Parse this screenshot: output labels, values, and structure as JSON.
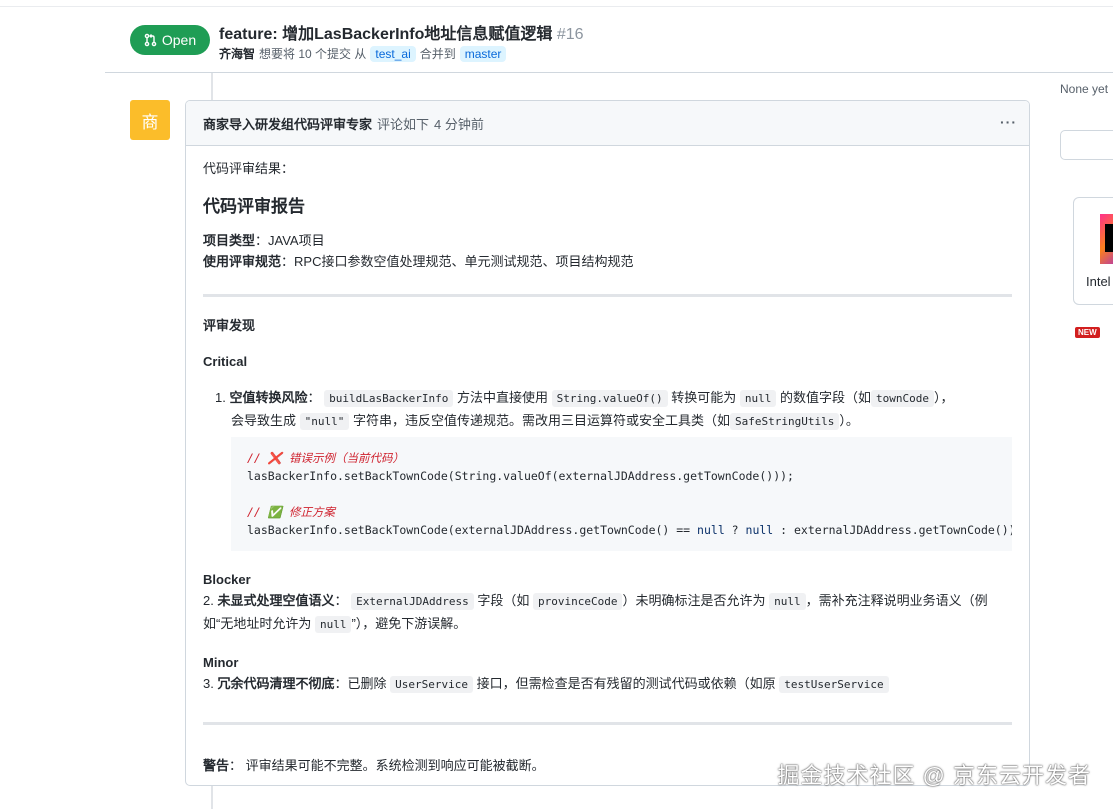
{
  "pr": {
    "status": "Open",
    "title": "feature: 增加LasBackerInfo地址信息赋值逻辑",
    "number": "#16",
    "author": "齐海智",
    "sub_text1": "想要将 10 个提交 从",
    "source_branch": "test_ai",
    "sub_text2": "合并到",
    "target_branch": "master"
  },
  "comment": {
    "avatar_char": "商",
    "author": "商家导入研发组代码评审专家",
    "action": "评论如下",
    "time": "4 分钟前",
    "menu": "···"
  },
  "review": {
    "intro": "代码评审结果：",
    "heading": "代码评审报告",
    "project_type_label": "项目类型",
    "project_type": "：JAVA项目",
    "spec_label": "使用评审规范",
    "spec": "：RPC接口参数空值处理规范、单元测试规范、项目结构规范",
    "findings": "评审发现",
    "critical": "Critical",
    "c1": {
      "num": "1.",
      "title": "空值转换风险",
      "t1": "：",
      "code1": "buildLasBackerInfo",
      "t2": "方法中直接使用",
      "code2": "String.valueOf()",
      "t3": "转换可能为",
      "code3": "null",
      "t4": "的数值字段（如",
      "code4": "townCode",
      "t5": "），",
      "t6": "会导致生成",
      "code5": "\"null\"",
      "t7": "字符串，违反空值传递规范。需改用三目运算符或安全工具类（如",
      "code6": "SafeStringUtils",
      "t8": "）。"
    },
    "code_block": {
      "comment1": "// ❌ 错误示例（当前代码）",
      "line1": "lasBackerInfo.setBackTownCode(String.valueOf(externalJDAddress.getTownCode()));",
      "comment2": "// ✅ 修正方案",
      "line2a": "lasBackerInfo.setBackTownCode(externalJDAddress.getTownCode() == ",
      "kw1": "null",
      "q": " ? ",
      "kw2": "null",
      "line2b": " : externalJDAddress.getTownCode());"
    },
    "blocker": "Blocker",
    "b2": {
      "num": "2.",
      "title": "未显式处理空值语义",
      "t1": "：",
      "code1": "ExternalJDAddress",
      "t2": "字段（如",
      "code2": "provinceCode",
      "t3": "）未明确标注是否允许为",
      "code3": "null",
      "t4": "，需补充注释说明业务语义（例如“无地址时允许为",
      "code4": "null",
      "t5": "”），避免下游误解。"
    },
    "minor": "Minor",
    "m3": {
      "num": "3.",
      "title": "冗余代码清理不彻底",
      "t1": "：已删除",
      "code1": "UserService",
      "t2": "接口，但需检查是否有残留的测试代码或依赖（如原",
      "code2": "testUserService"
    },
    "warning_label": "警告",
    "warning": "： 评审结果可能不完整。系统检测到响应可能被截断。"
  },
  "sidebar": {
    "reviewers": "None yet",
    "ad_text": "Intel",
    "badge": "NEW"
  },
  "watermark": "掘金技术社区 @ 京东云开发者"
}
